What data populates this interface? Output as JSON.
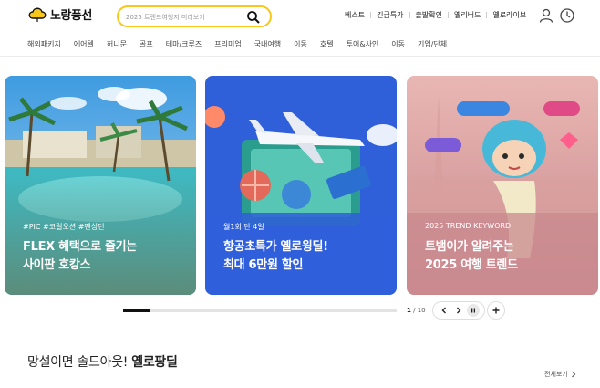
{
  "header": {
    "logo_text": "노랑풍선",
    "search_placeholder": "2025 트렌드여행지 미리보기",
    "quick_links": [
      "베스트",
      "긴급특가",
      "출발확인",
      "옐리버드",
      "옐로라이브"
    ]
  },
  "gnb": {
    "items": [
      "해외패키지",
      "에어텔",
      "허니문",
      "골프",
      "테마/크루즈",
      "프리미엄",
      "국내여행",
      "이동",
      "호텔",
      "투어&사인",
      "이동",
      "기업/단체"
    ]
  },
  "banners": [
    {
      "tag": "#PIC #코럴오션 #펜싱턴",
      "title_line1": "FLEX 혜택으로 즐기는",
      "title_line2": "사이판 호캉스",
      "color": "#6f9a86"
    },
    {
      "tag": "월1회 단 4일",
      "title_line1": "항공초특가 옐로윙딜!",
      "title_line2": "최대 6만원 할인",
      "color": "#2f5fd9"
    },
    {
      "tag": "2025 TREND KEYWORD",
      "title_line1": "트뱀이가 알려주는",
      "title_line2": "2025 여행 트렌드",
      "color": "#c98a8f"
    }
  ],
  "slider": {
    "current": "1",
    "separator": "/",
    "total": "10",
    "progress": 0.1
  },
  "section": {
    "title_prefix": "망설이면 솔드아웃!",
    "title_highlight": "옐로팡딜",
    "view_all": "전체보기"
  },
  "colors": {
    "accent": "#f7c71a",
    "text": "#222222"
  }
}
